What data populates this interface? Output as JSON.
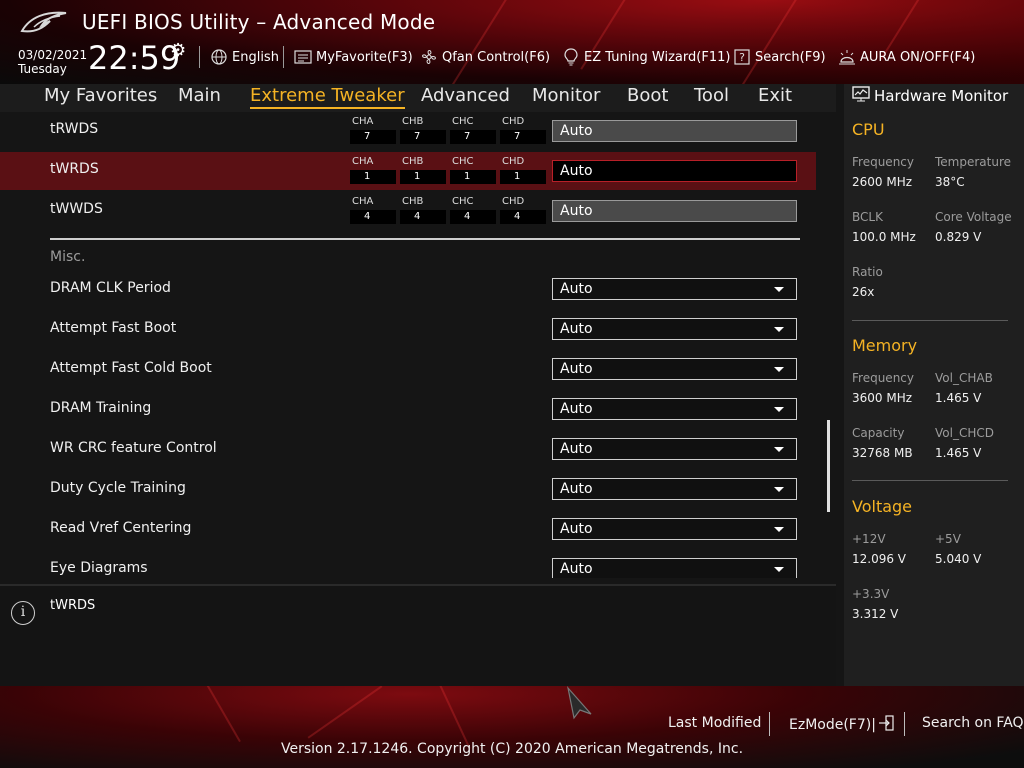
{
  "header": {
    "title": "UEFI BIOS Utility – Advanced Mode",
    "date": "03/02/2021",
    "day": "Tuesday",
    "time": "22:59",
    "toolbar": {
      "language": "English",
      "my_favorite": "MyFavorite(F3)",
      "qfan": "Qfan Control(F6)",
      "ez_tuning": "EZ Tuning Wizard(F11)",
      "search": "Search(F9)",
      "aura": "AURA ON/OFF(F4)"
    }
  },
  "nav": {
    "items": [
      "My Favorites",
      "Main",
      "Extreme Tweaker",
      "Advanced",
      "Monitor",
      "Boot",
      "Tool",
      "Exit"
    ],
    "active": "Extreme Tweaker"
  },
  "channel_rows": [
    {
      "label": "tRWDS",
      "channels": [
        {
          "name": "CHA",
          "value": "7"
        },
        {
          "name": "CHB",
          "value": "7"
        },
        {
          "name": "CHC",
          "value": "7"
        },
        {
          "name": "CHD",
          "value": "7"
        }
      ],
      "value": "Auto",
      "selected": false
    },
    {
      "label": "tWRDS",
      "channels": [
        {
          "name": "CHA",
          "value": "1"
        },
        {
          "name": "CHB",
          "value": "1"
        },
        {
          "name": "CHC",
          "value": "1"
        },
        {
          "name": "CHD",
          "value": "1"
        }
      ],
      "value": "Auto",
      "selected": true
    },
    {
      "label": "tWWDS",
      "channels": [
        {
          "name": "CHA",
          "value": "4"
        },
        {
          "name": "CHB",
          "value": "4"
        },
        {
          "name": "CHC",
          "value": "4"
        },
        {
          "name": "CHD",
          "value": "4"
        }
      ],
      "value": "Auto",
      "selected": false
    }
  ],
  "misc": {
    "header": "Misc.",
    "items": [
      {
        "label": "DRAM CLK Period",
        "value": "Auto"
      },
      {
        "label": "Attempt Fast Boot",
        "value": "Auto"
      },
      {
        "label": "Attempt Fast Cold Boot",
        "value": "Auto"
      },
      {
        "label": "DRAM Training",
        "value": "Auto"
      },
      {
        "label": "WR CRC feature Control",
        "value": "Auto"
      },
      {
        "label": "Duty Cycle Training",
        "value": "Auto"
      },
      {
        "label": "Read Vref Centering",
        "value": "Auto"
      },
      {
        "label": "Eye Diagrams",
        "value": "Auto"
      }
    ]
  },
  "help": {
    "text": "tWRDS"
  },
  "hardware_monitor": {
    "title": "Hardware Monitor",
    "cpu": {
      "title": "CPU",
      "frequency_label": "Frequency",
      "frequency": "2600 MHz",
      "temperature_label": "Temperature",
      "temperature": "38°C",
      "bclk_label": "BCLK",
      "bclk": "100.0 MHz",
      "core_voltage_label": "Core Voltage",
      "core_voltage": "0.829 V",
      "ratio_label": "Ratio",
      "ratio": "26x"
    },
    "memory": {
      "title": "Memory",
      "frequency_label": "Frequency",
      "frequency": "3600 MHz",
      "vol_chab_label": "Vol_CHAB",
      "vol_chab": "1.465 V",
      "capacity_label": "Capacity",
      "capacity": "32768 MB",
      "vol_chcd_label": "Vol_CHCD",
      "vol_chcd": "1.465 V"
    },
    "voltage": {
      "title": "Voltage",
      "v12_label": "+12V",
      "v12": "12.096 V",
      "v5_label": "+5V",
      "v5": "5.040 V",
      "v33_label": "+3.3V",
      "v33": "3.312 V"
    }
  },
  "footer": {
    "last_modified": "Last Modified",
    "ezmode": "EzMode(F7)|",
    "search_faq": "Search on FAQ",
    "version": "Version 2.17.1246. Copyright (C) 2020 American Megatrends, Inc."
  },
  "colors": {
    "accent": "#f5b324",
    "selected_row": "#5a1014",
    "header_red": "#9a0d12"
  }
}
